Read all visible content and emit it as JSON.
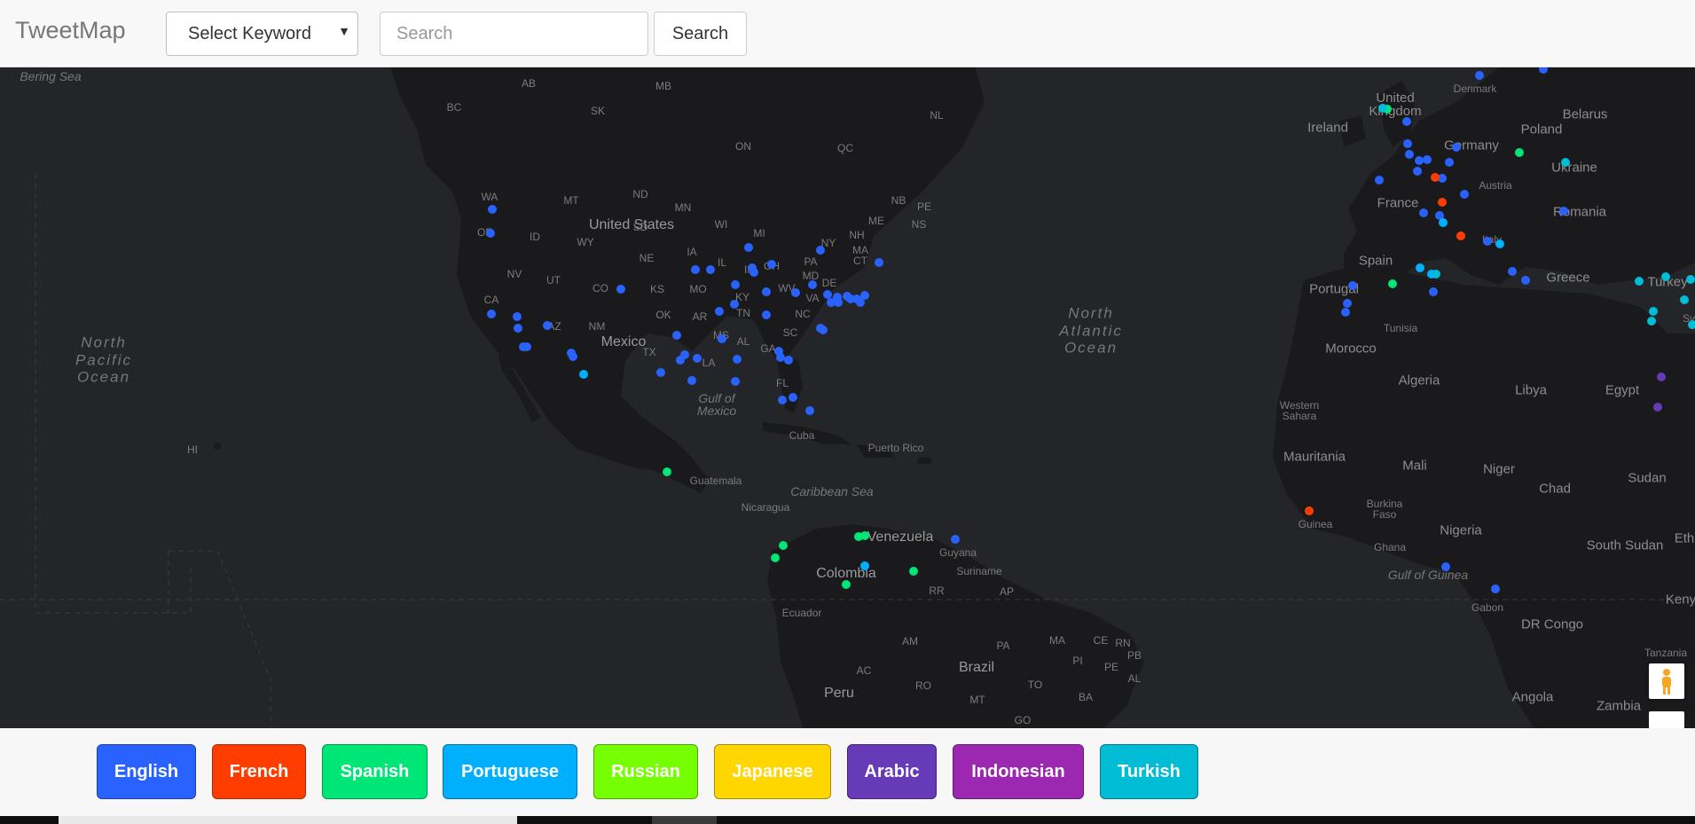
{
  "navbar": {
    "brand": "TweetMap",
    "keyword_select": {
      "selected": "Select Keyword"
    },
    "search": {
      "placeholder": "Search",
      "value": "",
      "button_label": "Search"
    }
  },
  "map": {
    "labels": {
      "bering_sea": "Bering Sea",
      "north_pacific_ocean": "North\nPacific\nOcean",
      "north_atlantic_ocean": "North\nAtlantic\nOcean",
      "gulf_of_mexico": "Gulf of\nMexico",
      "caribbean_sea": "Caribbean Sea",
      "gulf_of_guinea": "Gulf of Guinea",
      "united_states": "United States",
      "mexico": "Mexico",
      "cuba": "Cuba",
      "puerto_rico": "Puerto Rico",
      "guatemala": "Guatemala",
      "nicaragua": "Nicaragua",
      "venezuela": "Venezuela",
      "guyana": "Guyana",
      "suriname": "Suriname",
      "colombia": "Colombia",
      "ecuador": "Ecuador",
      "peru": "Peru",
      "brazil": "Brazil",
      "united_kingdom": "United\nKingdom",
      "ireland": "Ireland",
      "denmark": "Denmark",
      "belarus": "Belarus",
      "poland": "Poland",
      "germany": "Germany",
      "ukraine": "Ukraine",
      "austria": "Austria",
      "france": "France",
      "romania": "Romania",
      "italy": "Italy",
      "spain": "Spain",
      "portugal": "Portugal",
      "greece": "Greece",
      "turkey": "Turkey",
      "syria": "Sy",
      "tunisia": "Tunisia",
      "morocco": "Morocco",
      "algeria": "Algeria",
      "libya": "Libya",
      "egypt": "Egypt",
      "western_sahara": "Western\nSahara",
      "mauritania": "Mauritania",
      "mali": "Mali",
      "niger": "Niger",
      "chad": "Chad",
      "sudan": "Sudan",
      "burkina_faso": "Burkina\nFaso",
      "guinea": "Guinea",
      "ghana": "Ghana",
      "nigeria": "Nigeria",
      "south_sudan": "South Sudan",
      "ethiopia": "Eth",
      "kenya": "Keny",
      "gabon": "Gabon",
      "dr_congo": "DR Congo",
      "tanzania": "Tanzania",
      "angola": "Angola",
      "zambia": "Zambia",
      "states": [
        "AB",
        "MB",
        "BC",
        "SK",
        "ON",
        "QC",
        "NL",
        "WA",
        "MT",
        "ND",
        "MN",
        "NB",
        "PE",
        "NS",
        "ME",
        "OR",
        "ID",
        "WY",
        "SD",
        "WI",
        "MI",
        "NY",
        "NH",
        "MA",
        "NV",
        "UT",
        "CO",
        "NE",
        "IA",
        "IL",
        "OH",
        "PA",
        "CT",
        "KS",
        "MO",
        "IN",
        "WV",
        "MD",
        "DE",
        "VA",
        "CA",
        "KY",
        "AZ",
        "NM",
        "OK",
        "AR",
        "TN",
        "NC",
        "TX",
        "MS",
        "AL",
        "SC",
        "GA",
        "LA",
        "FL",
        "HI",
        "RR",
        "AP",
        "AM",
        "PA",
        "MA",
        "CE",
        "RN",
        "PB",
        "PI",
        "PE",
        "AL",
        "AC",
        "RO",
        "TO",
        "BA",
        "MT",
        "GO"
      ]
    },
    "tweet_colors": {
      "English": "#2962ff",
      "French": "#ff3d00",
      "Spanish": "#00e676",
      "Portuguese": "#00b0ff",
      "Turkish": "#00bcd4",
      "Arabic": "#673ab7"
    }
  },
  "legend": [
    {
      "label": "English",
      "color": "#2962ff"
    },
    {
      "label": "French",
      "color": "#ff3d00"
    },
    {
      "label": "Spanish",
      "color": "#00e676"
    },
    {
      "label": "Portuguese",
      "color": "#00b0ff"
    },
    {
      "label": "Russian",
      "color": "#76ff03"
    },
    {
      "label": "Japanese",
      "color": "#ffd600"
    },
    {
      "label": "Arabic",
      "color": "#673ab7"
    },
    {
      "label": "Indonesian",
      "color": "#9c27b0"
    },
    {
      "label": "Turkish",
      "color": "#00bcd4"
    }
  ]
}
